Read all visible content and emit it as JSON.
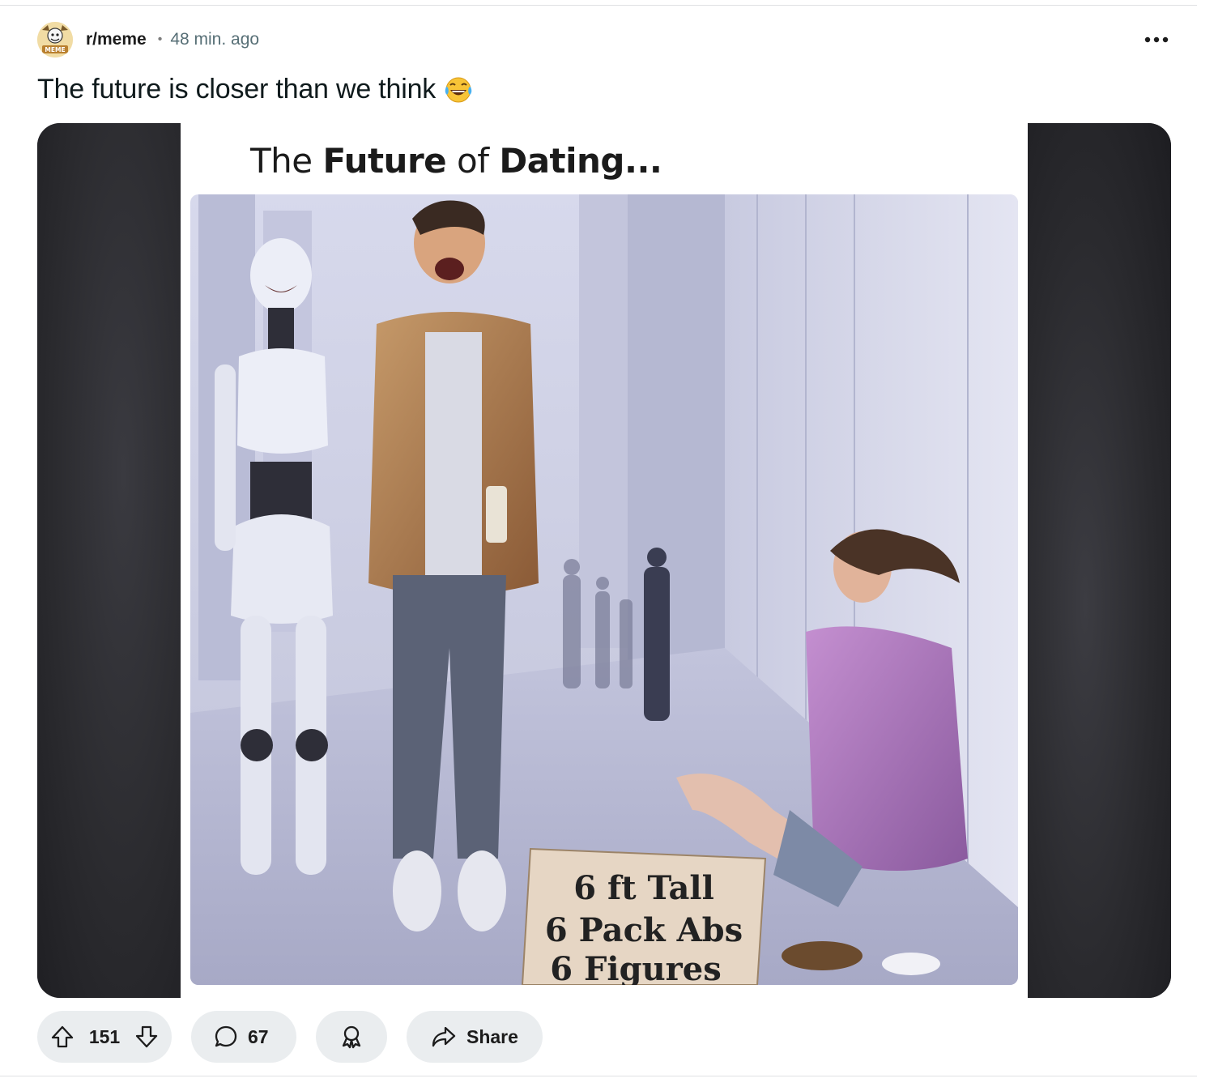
{
  "post": {
    "subreddit": "r/meme",
    "separator": "•",
    "time_ago": "48 min. ago",
    "title": "The future is closer than we think",
    "avatar_text": "MEME"
  },
  "media": {
    "heading_prefix": "The ",
    "heading_bold_1": "Future",
    "heading_mid": " of ",
    "heading_bold_2": "Dating...",
    "sign_lines": [
      "6 ft Tall",
      "6 Pack Abs",
      "6 Figures"
    ]
  },
  "actions": {
    "upvote_count": "151",
    "comment_count": "67",
    "share_label": "Share"
  },
  "icons": {
    "more": "more-horizontal-icon",
    "upvote": "upvote-arrow-icon",
    "downvote": "downvote-arrow-icon",
    "comment": "comment-bubble-icon",
    "award": "award-icon",
    "share": "share-arrow-icon",
    "emoji": "tears-of-joy-emoji"
  }
}
